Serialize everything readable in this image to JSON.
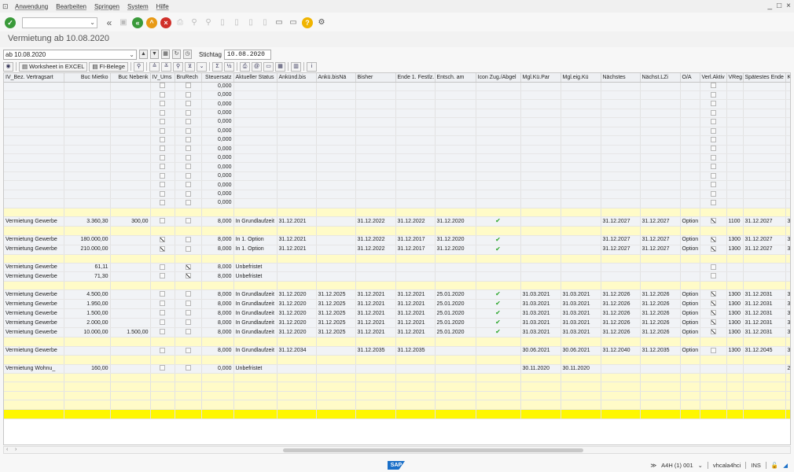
{
  "menu": [
    "Anwendung",
    "Bearbeiten",
    "Springen",
    "System",
    "Hilfe"
  ],
  "window_controls": [
    "_",
    "□",
    "×"
  ],
  "page_title": "Vermietung ab 10.08.2020",
  "variant_value": "ab 10.08.2020",
  "stichtag": {
    "label": "Stichtag",
    "value": "10.08.2020"
  },
  "alv_buttons": {
    "excel": "Worksheet in EXCEL",
    "fibelege": "FI-Belege"
  },
  "columns": [
    "IV_Bez. Vertragsart",
    "Buc Mietko",
    "Buc Nebenk",
    "IV_Ums",
    "BruRech",
    "Steuersatz",
    "Aktueller Status",
    "Ankünd.bis",
    "Ankü.bisNä",
    "Bisher",
    "Ende 1. Festlz.",
    "Entsch. am",
    "Icon Zug./Abgel",
    "Mgl.Kü.Par",
    "Mgl.eig.Kü",
    "Nächstes",
    "Nächst.LZi",
    "O/A",
    "Verl.Aktiv",
    "VReg",
    "Spätestes Ende",
    "K"
  ],
  "rows": [
    {
      "t": "d",
      "c": [
        "",
        "",
        "",
        "□",
        "□",
        "0,000",
        "",
        "",
        "",
        "",
        "",
        "",
        "",
        "",
        "",
        "",
        "",
        "",
        "□",
        "",
        "",
        ""
      ]
    },
    {
      "t": "d",
      "c": [
        "",
        "",
        "",
        "□",
        "□",
        "0,000",
        "",
        "",
        "",
        "",
        "",
        "",
        "",
        "",
        "",
        "",
        "",
        "",
        "□",
        "",
        "",
        ""
      ]
    },
    {
      "t": "d",
      "c": [
        "",
        "",
        "",
        "□",
        "□",
        "0,000",
        "",
        "",
        "",
        "",
        "",
        "",
        "",
        "",
        "",
        "",
        "",
        "",
        "□",
        "",
        "",
        ""
      ]
    },
    {
      "t": "d",
      "c": [
        "",
        "",
        "",
        "□",
        "□",
        "0,000",
        "",
        "",
        "",
        "",
        "",
        "",
        "",
        "",
        "",
        "",
        "",
        "",
        "□",
        "",
        "",
        ""
      ]
    },
    {
      "t": "d",
      "c": [
        "",
        "",
        "",
        "□",
        "□",
        "0,000",
        "",
        "",
        "",
        "",
        "",
        "",
        "",
        "",
        "",
        "",
        "",
        "",
        "□",
        "",
        "",
        ""
      ]
    },
    {
      "t": "d",
      "c": [
        "",
        "",
        "",
        "□",
        "□",
        "0,000",
        "",
        "",
        "",
        "",
        "",
        "",
        "",
        "",
        "",
        "",
        "",
        "",
        "□",
        "",
        "",
        ""
      ]
    },
    {
      "t": "d",
      "c": [
        "",
        "",
        "",
        "□",
        "□",
        "0,000",
        "",
        "",
        "",
        "",
        "",
        "",
        "",
        "",
        "",
        "",
        "",
        "",
        "□",
        "",
        "",
        ""
      ]
    },
    {
      "t": "d",
      "c": [
        "",
        "",
        "",
        "□",
        "□",
        "0,000",
        "",
        "",
        "",
        "",
        "",
        "",
        "",
        "",
        "",
        "",
        "",
        "",
        "□",
        "",
        "",
        ""
      ]
    },
    {
      "t": "d",
      "c": [
        "",
        "",
        "",
        "□",
        "□",
        "0,000",
        "",
        "",
        "",
        "",
        "",
        "",
        "",
        "",
        "",
        "",
        "",
        "",
        "□",
        "",
        "",
        ""
      ]
    },
    {
      "t": "d",
      "c": [
        "",
        "",
        "",
        "□",
        "□",
        "0,000",
        "",
        "",
        "",
        "",
        "",
        "",
        "",
        "",
        "",
        "",
        "",
        "",
        "□",
        "",
        "",
        ""
      ]
    },
    {
      "t": "d",
      "c": [
        "",
        "",
        "",
        "□",
        "□",
        "0,000",
        "",
        "",
        "",
        "",
        "",
        "",
        "",
        "",
        "",
        "",
        "",
        "",
        "□",
        "",
        "",
        ""
      ]
    },
    {
      "t": "d",
      "c": [
        "",
        "",
        "",
        "□",
        "□",
        "0,000",
        "",
        "",
        "",
        "",
        "",
        "",
        "",
        "",
        "",
        "",
        "",
        "",
        "□",
        "",
        "",
        ""
      ]
    },
    {
      "t": "d",
      "c": [
        "",
        "",
        "",
        "□",
        "□",
        "0,000",
        "",
        "",
        "",
        "",
        "",
        "",
        "",
        "",
        "",
        "",
        "",
        "",
        "□",
        "",
        "",
        ""
      ]
    },
    {
      "t": "d",
      "c": [
        "",
        "",
        "",
        "□",
        "□",
        "0,000",
        "",
        "",
        "",
        "",
        "",
        "",
        "",
        "",
        "",
        "",
        "",
        "",
        "□",
        "",
        "",
        ""
      ]
    },
    {
      "t": "s",
      "c": []
    },
    {
      "t": "d",
      "c": [
        "Vermietung Gewerbe",
        "3.360,30",
        "300,00",
        "□",
        "□",
        "8,000",
        "In Grundlaufzeit",
        "31.12.2021",
        "",
        "31.12.2022",
        "31.12.2022",
        "31.12.2020",
        "ok",
        "",
        "",
        "31.12.2027",
        "31.12.2027",
        "Option",
        "☑",
        "1100",
        "31.12.2027",
        "3"
      ]
    },
    {
      "t": "s",
      "c": []
    },
    {
      "t": "d",
      "c": [
        "Vermietung Gewerbe",
        "180.000,00",
        "",
        "☑",
        "□",
        "8,000",
        "In 1. Option",
        "31.12.2021",
        "",
        "31.12.2022",
        "31.12.2017",
        "31.12.2020",
        "ok",
        "",
        "",
        "31.12.2027",
        "31.12.2027",
        "Option",
        "☑",
        "1300",
        "31.12.2027",
        "3"
      ]
    },
    {
      "t": "d",
      "c": [
        "Vermietung Gewerbe",
        "210.000,00",
        "",
        "☑",
        "□",
        "8,000",
        "In 1. Option",
        "31.12.2021",
        "",
        "31.12.2022",
        "31.12.2017",
        "31.12.2020",
        "ok",
        "",
        "",
        "31.12.2027",
        "31.12.2027",
        "Option",
        "☑",
        "1300",
        "31.12.2027",
        "3"
      ]
    },
    {
      "t": "s",
      "c": []
    },
    {
      "t": "d",
      "c": [
        "Vermietung Gewerbe",
        "61,11",
        "",
        "□",
        "☑",
        "8,000",
        "Unbefristet",
        "",
        "",
        "",
        "",
        "",
        "",
        "",
        "",
        "",
        "",
        "",
        "□",
        "",
        "",
        ""
      ]
    },
    {
      "t": "d",
      "c": [
        "Vermietung Gewerbe",
        "71,30",
        "",
        "□",
        "☑",
        "8,000",
        "Unbefristet",
        "",
        "",
        "",
        "",
        "",
        "",
        "",
        "",
        "",
        "",
        "",
        "□",
        "",
        "",
        ""
      ]
    },
    {
      "t": "s",
      "c": []
    },
    {
      "t": "d",
      "c": [
        "Vermietung Gewerbe",
        "4.500,00",
        "",
        "□",
        "□",
        "8,000",
        "In Grundlaufzeit",
        "31.12.2020",
        "31.12.2025",
        "31.12.2021",
        "31.12.2021",
        "25.01.2020",
        "ok",
        "31.03.2021",
        "31.03.2021",
        "31.12.2026",
        "31.12.2026",
        "Option",
        "☑",
        "1300",
        "31.12.2031",
        "3"
      ]
    },
    {
      "t": "d",
      "c": [
        "Vermietung Gewerbe",
        "1.950,00",
        "",
        "□",
        "□",
        "8,000",
        "In Grundlaufzeit",
        "31.12.2020",
        "31.12.2025",
        "31.12.2021",
        "31.12.2021",
        "25.01.2020",
        "ok",
        "31.03.2021",
        "31.03.2021",
        "31.12.2026",
        "31.12.2026",
        "Option",
        "☑",
        "1300",
        "31.12.2031",
        "3"
      ]
    },
    {
      "t": "d",
      "c": [
        "Vermietung Gewerbe",
        "1.500,00",
        "",
        "□",
        "□",
        "8,000",
        "In Grundlaufzeit",
        "31.12.2020",
        "31.12.2025",
        "31.12.2021",
        "31.12.2021",
        "25.01.2020",
        "ok",
        "31.03.2021",
        "31.03.2021",
        "31.12.2026",
        "31.12.2026",
        "Option",
        "☑",
        "1300",
        "31.12.2031",
        "3"
      ]
    },
    {
      "t": "d",
      "c": [
        "Vermietung Gewerbe",
        "2.000,00",
        "",
        "□",
        "□",
        "8,000",
        "In Grundlaufzeit",
        "31.12.2020",
        "31.12.2025",
        "31.12.2021",
        "31.12.2021",
        "25.01.2020",
        "ok",
        "31.03.2021",
        "31.03.2021",
        "31.12.2026",
        "31.12.2026",
        "Option",
        "☑",
        "1300",
        "31.12.2031",
        "3"
      ]
    },
    {
      "t": "d",
      "c": [
        "Vermietung Gewerbe",
        "10.000,00",
        "1.500,00",
        "□",
        "□",
        "8,000",
        "In Grundlaufzeit",
        "31.12.2020",
        "31.12.2025",
        "31.12.2021",
        "31.12.2021",
        "25.01.2020",
        "ok",
        "31.03.2021",
        "31.03.2021",
        "31.12.2026",
        "31.12.2026",
        "Option",
        "☑",
        "1300",
        "31.12.2031",
        "3"
      ]
    },
    {
      "t": "s",
      "c": []
    },
    {
      "t": "d",
      "c": [
        "Vermietung Gewerbe",
        "",
        "",
        "□",
        "□",
        "8,000",
        "In Grundlaufzeit",
        "31.12.2034",
        "",
        "31.12.2035",
        "31.12.2035",
        "",
        "",
        "30.06.2021",
        "30.06.2021",
        "31.12.2040",
        "31.12.2035",
        "Option",
        "□",
        "1300",
        "31.12.2045",
        "3"
      ]
    },
    {
      "t": "s",
      "c": []
    },
    {
      "t": "d",
      "c": [
        "Vermietung Wohnu_",
        "160,00",
        "",
        "□",
        "□",
        "0,000",
        "Unbefristet",
        "",
        "",
        "",
        "",
        "",
        "",
        "30.11.2020",
        "30.11.2020",
        "",
        "",
        "",
        "",
        "",
        "",
        "2"
      ]
    },
    {
      "t": "s",
      "c": []
    },
    {
      "t": "s",
      "c": []
    },
    {
      "t": "s",
      "c": []
    },
    {
      "t": "s",
      "c": []
    },
    {
      "t": "y",
      "c": []
    }
  ],
  "status": {
    "system": "A4H (1) 001",
    "server": "vhcala4hci",
    "mode": "INS"
  }
}
